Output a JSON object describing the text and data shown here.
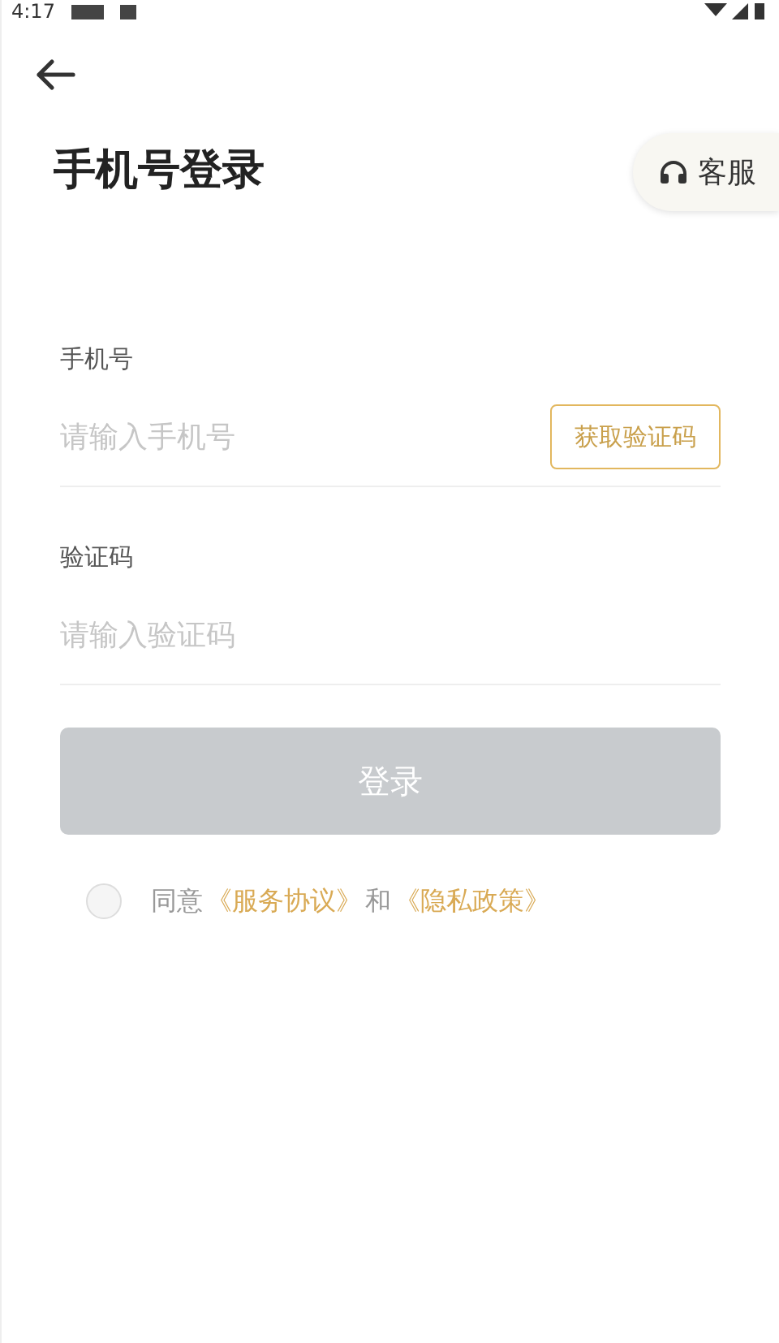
{
  "status_bar": {
    "time": "4:17"
  },
  "title": "手机号登录",
  "service_button": {
    "label": "客服"
  },
  "fields": [
    {
      "label": "手机号",
      "placeholder": "请输入手机号",
      "action": "获取验证码"
    },
    {
      "label": "验证码",
      "placeholder": "请输入验证码"
    }
  ],
  "login_button": {
    "label": "登录",
    "disabled": true
  },
  "agreement": {
    "checked": false,
    "parts": [
      {
        "kind": "text",
        "text": "同意"
      },
      {
        "kind": "link",
        "text": "《服务协议》"
      },
      {
        "kind": "text",
        "text": "和"
      },
      {
        "kind": "link",
        "text": "《隐私政策》"
      }
    ]
  }
}
